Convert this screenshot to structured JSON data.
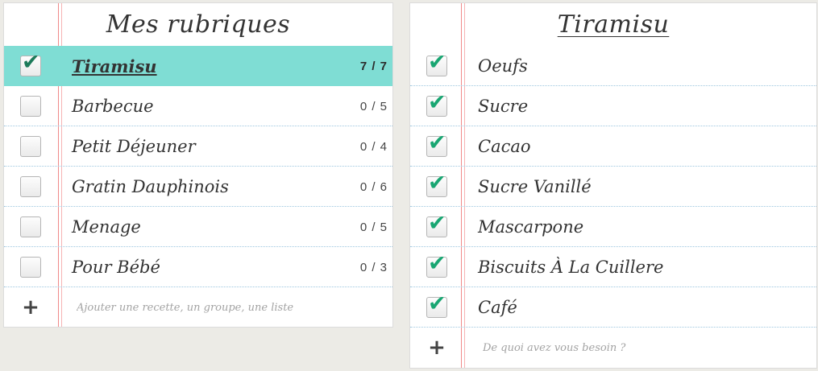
{
  "left_panel": {
    "title": "Mes rubriques",
    "items": [
      {
        "label": "Tiramisu",
        "count": "7 / 7",
        "checked": true,
        "active": true
      },
      {
        "label": "Barbecue",
        "count": "0 / 5",
        "checked": false,
        "active": false
      },
      {
        "label": "Petit Déjeuner",
        "count": "0 / 4",
        "checked": false,
        "active": false
      },
      {
        "label": "Gratin Dauphinois",
        "count": "0 / 6",
        "checked": false,
        "active": false
      },
      {
        "label": "Menage",
        "count": "0 / 5",
        "checked": false,
        "active": false
      },
      {
        "label": "Pour Bébé",
        "count": "0 / 3",
        "checked": false,
        "active": false
      }
    ],
    "add_icon": "plus-icon",
    "add_placeholder": "Ajouter une recette, un groupe, une liste"
  },
  "right_panel": {
    "title": "Tiramisu",
    "items": [
      {
        "label": "Oeufs",
        "checked": true
      },
      {
        "label": "Sucre",
        "checked": true
      },
      {
        "label": "Cacao",
        "checked": true
      },
      {
        "label": "Sucre Vanillé",
        "checked": true
      },
      {
        "label": "Mascarpone",
        "checked": true
      },
      {
        "label": "Biscuits À La Cuillere",
        "checked": true
      },
      {
        "label": "Café",
        "checked": true
      }
    ],
    "add_icon": "plus-icon",
    "add_placeholder": "De quoi avez vous besoin ?"
  },
  "colors": {
    "active_row": "#7fddd4",
    "check_mark": "#19a672",
    "margin_line": "#f08a8a",
    "rule_line": "#9ec7e0",
    "background": "#ecebe6"
  }
}
